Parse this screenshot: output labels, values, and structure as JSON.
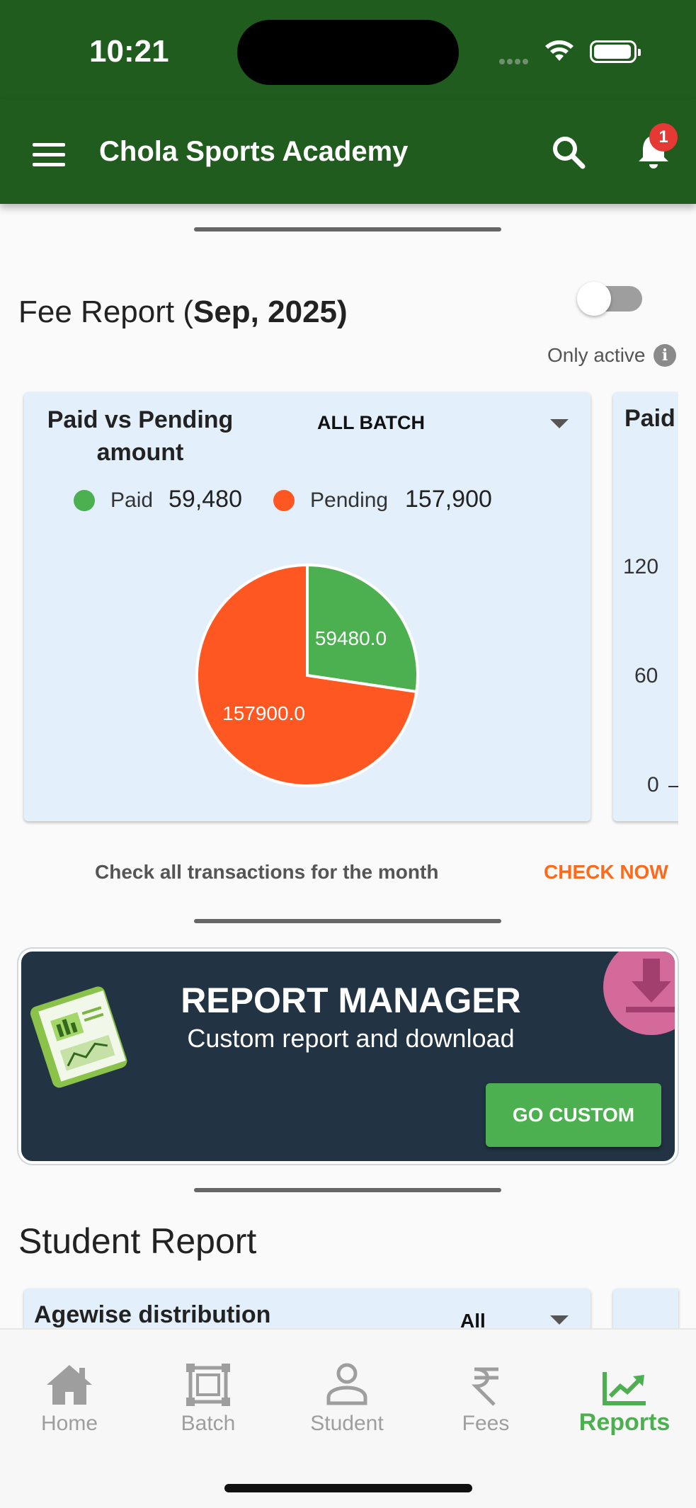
{
  "status_bar": {
    "time": "10:21"
  },
  "app_bar": {
    "title": "Chola Sports Academy",
    "notification_count": "1"
  },
  "fee_report": {
    "title_prefix": "Fee Report (",
    "title_period": "Sep, 2025)",
    "only_active_label": "Only active",
    "toggle_on": false,
    "cards": [
      {
        "title": "Paid vs Pending amount",
        "batch_select": "ALL BATCH",
        "legend": [
          {
            "label": "Paid",
            "value": "59,480",
            "color": "#4caf50"
          },
          {
            "label": "Pending",
            "value": "157,900",
            "color": "#ff5722"
          }
        ]
      },
      {
        "title": "Paid",
        "axis_ticks": [
          "120",
          "60",
          "0"
        ]
      }
    ],
    "check_text": "Check all transactions for the month",
    "check_button": "CHECK NOW"
  },
  "chart_data": {
    "type": "pie",
    "slices": [
      {
        "label": "Paid",
        "value": 59480.0,
        "display": "59480.0",
        "color": "#4caf50"
      },
      {
        "label": "Pending",
        "value": 157900.0,
        "display": "157900.0",
        "color": "#ff5722"
      }
    ]
  },
  "report_manager": {
    "title": "REPORT MANAGER",
    "subtitle": "Custom report and download",
    "button": "GO CUSTOM"
  },
  "student_report": {
    "title": "Student Report",
    "card_title": "Agewise distribution",
    "filter": "All"
  },
  "bottom_nav": {
    "items": [
      {
        "label": "Home",
        "icon": "home-icon"
      },
      {
        "label": "Batch",
        "icon": "batch-icon"
      },
      {
        "label": "Student",
        "icon": "student-icon"
      },
      {
        "label": "Fees",
        "icon": "rupee-icon"
      },
      {
        "label": "Reports",
        "icon": "trending-chart-icon",
        "active": true
      }
    ]
  }
}
